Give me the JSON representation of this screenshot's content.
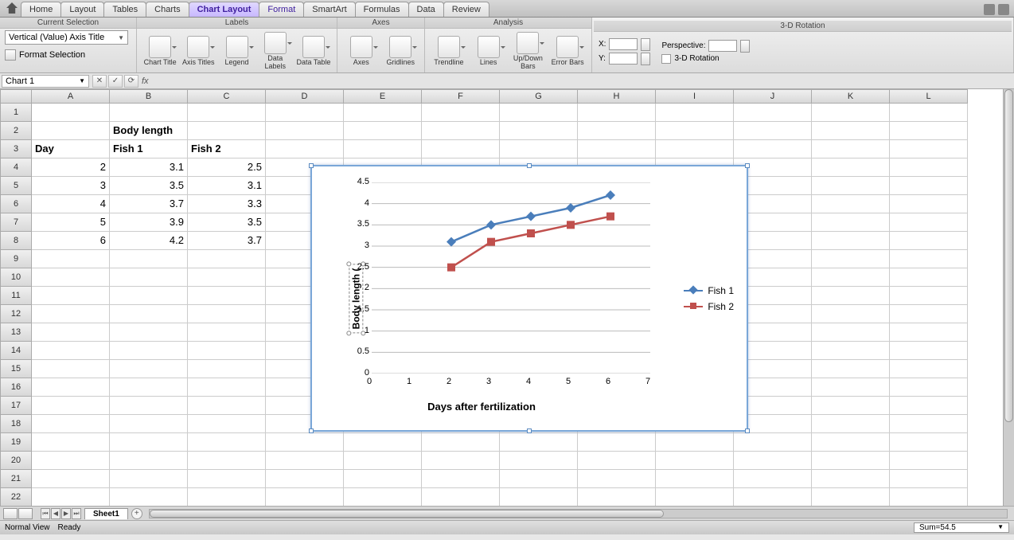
{
  "tabs": {
    "home": "Home",
    "layout": "Layout",
    "tables": "Tables",
    "charts": "Charts",
    "chartlayout": "Chart Layout",
    "format": "Format",
    "smartart": "SmartArt",
    "formulas": "Formulas",
    "data": "Data",
    "review": "Review"
  },
  "ribbon": {
    "groups": {
      "cursel": "Current Selection",
      "labels": "Labels",
      "axes": "Axes",
      "analysis": "Analysis",
      "rot3d": "3-D Rotation"
    },
    "cursel": {
      "dropdown": "Vertical (Value) Axis Title",
      "format_selection": "Format Selection"
    },
    "labels": {
      "chart_title": "Chart\nTitle",
      "axis_titles": "Axis\nTitles",
      "legend": "Legend",
      "data_labels": "Data\nLabels",
      "data_table": "Data\nTable"
    },
    "axes": {
      "axes": "Axes",
      "gridlines": "Gridlines"
    },
    "analysis": {
      "trendline": "Trendline",
      "lines": "Lines",
      "updown": "Up/Down\nBars",
      "error": "Error Bars"
    },
    "rot": {
      "x": "X:",
      "y": "Y:",
      "perspective": "Perspective:",
      "chk": "3-D Rotation"
    }
  },
  "namebox": "Chart 1",
  "columns": [
    "A",
    "B",
    "C",
    "D",
    "E",
    "F",
    "G",
    "H",
    "I",
    "J",
    "K",
    "L"
  ],
  "cells": {
    "B2": "Body length",
    "A3": "Day",
    "B3": "Fish 1",
    "C3": "Fish 2",
    "A4": "2",
    "B4": "3.1",
    "C4": "2.5",
    "A5": "3",
    "B5": "3.5",
    "C5": "3.1",
    "A6": "4",
    "B6": "3.7",
    "C6": "3.3",
    "A7": "5",
    "B7": "3.9",
    "C7": "3.5",
    "A8": "6",
    "B8": "4.2",
    "C8": "3.7"
  },
  "chart_data": {
    "type": "line",
    "x": [
      2,
      3,
      4,
      5,
      6
    ],
    "series": [
      {
        "name": "Fish 1",
        "values": [
          3.1,
          3.5,
          3.7,
          3.9,
          4.2
        ],
        "color": "#4a7ebb",
        "marker": "diamond"
      },
      {
        "name": "Fish 2",
        "values": [
          2.5,
          3.1,
          3.3,
          3.5,
          3.7
        ],
        "color": "#c0504d",
        "marker": "square"
      }
    ],
    "xlabel": "Days after fertilization",
    "ylabel": "Body length (",
    "xlim": [
      0,
      7
    ],
    "ylim": [
      0,
      4.5
    ],
    "xticks": [
      0,
      1,
      2,
      3,
      4,
      5,
      6,
      7
    ],
    "yticks": [
      0,
      0.5,
      1,
      1.5,
      2,
      2.5,
      3,
      3.5,
      4,
      4.5
    ]
  },
  "sheet": {
    "name": "Sheet1"
  },
  "status": {
    "view": "Normal View",
    "state": "Ready",
    "sum": "Sum=54.5"
  }
}
